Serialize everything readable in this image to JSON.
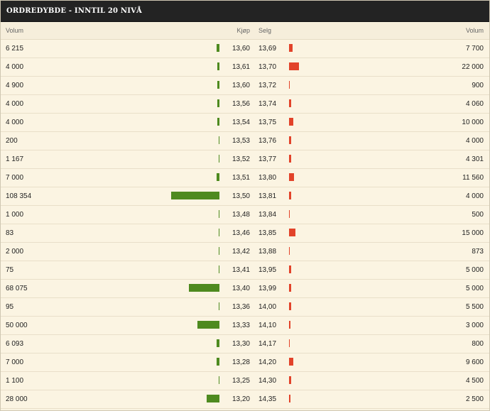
{
  "title": "ORDREDYBDE - INNTIL 20 NIVÅ",
  "columns": {
    "buy_volume": "Volum",
    "buy_price": "Kjøp",
    "sell_price": "Selg",
    "sell_volume": "Volum"
  },
  "colors": {
    "buy_bar": "#4e8a1f",
    "sell_bar": "#e2432a",
    "header_bg": "#232323",
    "background": "#faf3e1"
  },
  "bar_scale_max_volume": 108354,
  "rows": [
    {
      "buy_volume": "6 215",
      "buy_price": "13,60",
      "sell_price": "13,69",
      "sell_volume": "7 700"
    },
    {
      "buy_volume": "4 000",
      "buy_price": "13,61",
      "sell_price": "13,70",
      "sell_volume": "22 000"
    },
    {
      "buy_volume": "4 900",
      "buy_price": "13,60",
      "sell_price": "13,72",
      "sell_volume": "900"
    },
    {
      "buy_volume": "4 000",
      "buy_price": "13,56",
      "sell_price": "13,74",
      "sell_volume": "4 060"
    },
    {
      "buy_volume": "4 000",
      "buy_price": "13,54",
      "sell_price": "13,75",
      "sell_volume": "10 000"
    },
    {
      "buy_volume": "200",
      "buy_price": "13,53",
      "sell_price": "13,76",
      "sell_volume": "4 000"
    },
    {
      "buy_volume": "1 167",
      "buy_price": "13,52",
      "sell_price": "13,77",
      "sell_volume": "4 301"
    },
    {
      "buy_volume": "7 000",
      "buy_price": "13,51",
      "sell_price": "13,80",
      "sell_volume": "11 560"
    },
    {
      "buy_volume": "108 354",
      "buy_price": "13,50",
      "sell_price": "13,81",
      "sell_volume": "4 000"
    },
    {
      "buy_volume": "1 000",
      "buy_price": "13,48",
      "sell_price": "13,84",
      "sell_volume": "500"
    },
    {
      "buy_volume": "83",
      "buy_price": "13,46",
      "sell_price": "13,85",
      "sell_volume": "15 000"
    },
    {
      "buy_volume": "2 000",
      "buy_price": "13,42",
      "sell_price": "13,88",
      "sell_volume": "873"
    },
    {
      "buy_volume": "75",
      "buy_price": "13,41",
      "sell_price": "13,95",
      "sell_volume": "5 000"
    },
    {
      "buy_volume": "68 075",
      "buy_price": "13,40",
      "sell_price": "13,99",
      "sell_volume": "5 000"
    },
    {
      "buy_volume": "95",
      "buy_price": "13,36",
      "sell_price": "14,00",
      "sell_volume": "5 500"
    },
    {
      "buy_volume": "50 000",
      "buy_price": "13,33",
      "sell_price": "14,10",
      "sell_volume": "3 000"
    },
    {
      "buy_volume": "6 093",
      "buy_price": "13,30",
      "sell_price": "14,17",
      "sell_volume": "800"
    },
    {
      "buy_volume": "7 000",
      "buy_price": "13,28",
      "sell_price": "14,20",
      "sell_volume": "9 600"
    },
    {
      "buy_volume": "1 100",
      "buy_price": "13,25",
      "sell_price": "14,30",
      "sell_volume": "4 500"
    },
    {
      "buy_volume": "28 000",
      "buy_price": "13,20",
      "sell_price": "14,35",
      "sell_volume": "2 500"
    }
  ]
}
